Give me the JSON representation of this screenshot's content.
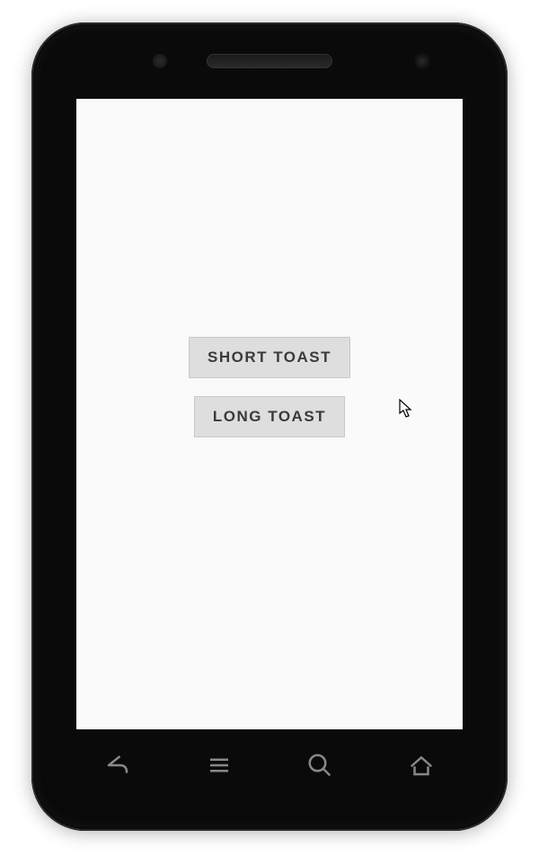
{
  "buttons": {
    "short_toast_label": "SHORT TOAST",
    "long_toast_label": "LONG  TOAST"
  },
  "nav": {
    "back": "back-icon",
    "menu": "menu-icon",
    "search": "search-icon",
    "home": "home-icon"
  }
}
